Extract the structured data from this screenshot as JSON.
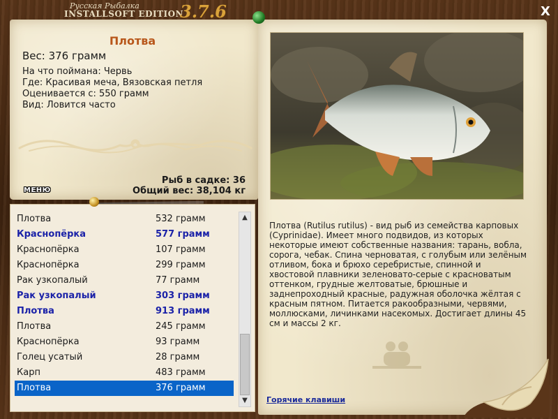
{
  "app": {
    "subtitle": "Русская Рыбалка",
    "edition": "INSTALLSOFT EDITION",
    "version": "3.7.6"
  },
  "close_label": "X",
  "catch": {
    "name": "Плотва",
    "weight": "Вес: 376 грамм",
    "bait": "На что поймана: Червь",
    "place": "Где: Красивая меча, Вязовская петля",
    "value": "Оценивается с: 550 грамм",
    "kind": "Вид: Ловится часто"
  },
  "totals": {
    "count": "Рыб в садке: 36",
    "weight": "Общий вес: 38,104 кг"
  },
  "menu_label": "МЕНЮ",
  "list": [
    {
      "name": "Плотва",
      "weight": "532 грамм",
      "bold": false,
      "selected": false
    },
    {
      "name": "Краснопёрка",
      "weight": "577 грамм",
      "bold": true,
      "selected": false
    },
    {
      "name": "Краснопёрка",
      "weight": "107 грамм",
      "bold": false,
      "selected": false
    },
    {
      "name": "Краснопёрка",
      "weight": "299 грамм",
      "bold": false,
      "selected": false
    },
    {
      "name": "Рак узкопалый",
      "weight": "77 грамм",
      "bold": false,
      "selected": false
    },
    {
      "name": "Рак узкопалый",
      "weight": "303 грамм",
      "bold": true,
      "selected": false
    },
    {
      "name": "Плотва",
      "weight": "913 грамм",
      "bold": true,
      "selected": false
    },
    {
      "name": "Плотва",
      "weight": "245 грамм",
      "bold": false,
      "selected": false
    },
    {
      "name": "Краснопёрка",
      "weight": "93 грамм",
      "bold": false,
      "selected": false
    },
    {
      "name": "Голец усатый",
      "weight": "28 грамм",
      "bold": false,
      "selected": false
    },
    {
      "name": "Карп",
      "weight": "483 грамм",
      "bold": false,
      "selected": false
    },
    {
      "name": "Плотва",
      "weight": "376 грамм",
      "bold": false,
      "selected": true
    }
  ],
  "scroll": {
    "up_icon": "▲",
    "down_icon": "▼"
  },
  "description": "Плотва (Rutilus rutilus) - вид рыб из семейства карповых (Cyprinidae). Имеет много подвидов, из которых некоторые имеют собственные названия: тарань, вобла, сорога, чебак. Спина черноватая, с голубым или зелёным отливом, бока и брюхо серебристые, спинной и хвостовой плавники зеленовато-серые с красноватым оттенком, грудные желтоватые, брюшные и заднепроходный красные, радужная оболочка жёлтая с красным пятном. Питается ракообразными, червями, моллюсками, личинками насекомых. Достигает длины 45 см и массы 2 кг.",
  "hotkeys_label": "Горячие клавиши",
  "colors": {
    "accent_title": "#b8571b",
    "bold_row": "#1b22a8",
    "selection": "#0a64c8",
    "link": "#1a2a9a"
  }
}
